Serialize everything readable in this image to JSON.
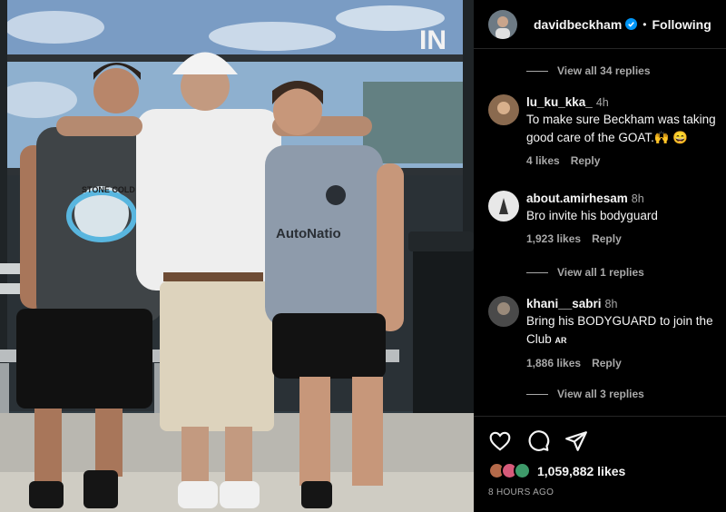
{
  "post": {
    "username": "davidbeckham",
    "follow_label": "Following",
    "separator": "•",
    "likes": "1,059,882 likes",
    "timestamp": "8 HOURS AGO"
  },
  "photo": {
    "shirt_brand": "AutoNatio",
    "tank_print": "STONE COLD",
    "window_letters": "IN"
  },
  "replies": [
    {
      "label": "View all 34 replies"
    },
    {
      "label": "View all 1 replies"
    },
    {
      "label": "View all 3 replies"
    }
  ],
  "comments": [
    {
      "user": "lu_ku_kka_",
      "time": "4h",
      "text": "To make sure Beckham was taking good care of the GOAT.🙌 😄",
      "likes": "4 likes",
      "reply": "Reply"
    },
    {
      "user": "about.amirhesam",
      "time": "8h",
      "text": "Bro invite his bodyguard",
      "likes": "1,923 likes",
      "reply": "Reply"
    },
    {
      "user": "khani__sabri",
      "time": "8h",
      "text": "Bring his BODYGUARD to join the Club",
      "tag": "AR",
      "likes": "1,886 likes",
      "reply": "Reply"
    }
  ],
  "icons": [
    "heart-icon",
    "comment-icon",
    "share-icon",
    "verified-badge-icon"
  ],
  "colors": {
    "background": "#000000",
    "muted_text": "#a8a8a8",
    "verified": "#0095f6",
    "divider": "#262626"
  }
}
